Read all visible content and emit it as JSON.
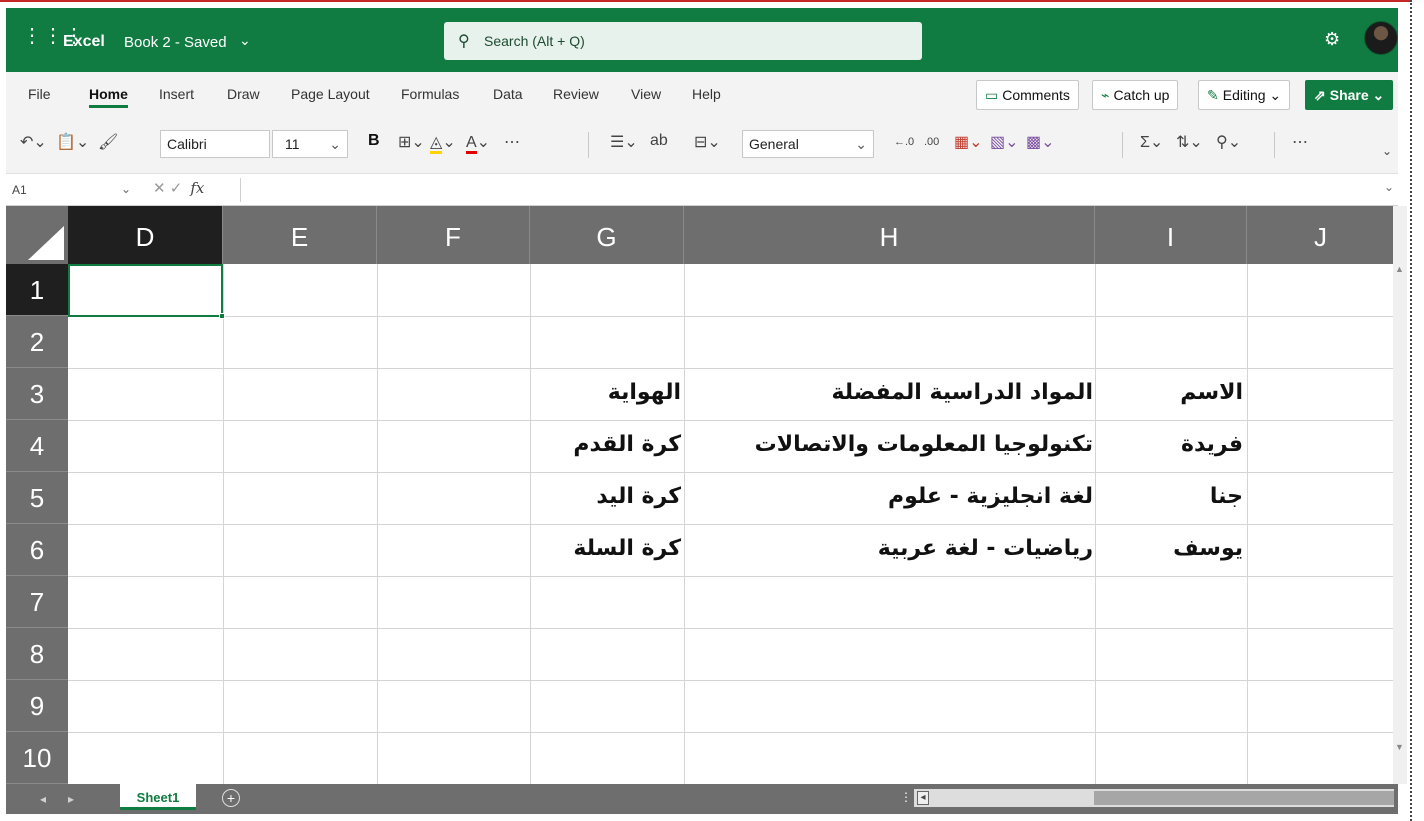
{
  "titlebar": {
    "app_name": "Excel",
    "doc_name": "Book 2 - Saved",
    "search_placeholder": "Search (Alt + Q)"
  },
  "menu": {
    "tabs": [
      "File",
      "Home",
      "Insert",
      "Draw",
      "Page Layout",
      "Formulas",
      "Data",
      "Review",
      "View",
      "Help"
    ],
    "active_tab": "Home",
    "comments_label": "Comments",
    "catchup_label": "Catch up",
    "editing_label": "Editing",
    "share_label": "Share"
  },
  "toolbar": {
    "font_name": "Calibri",
    "font_size": "11",
    "number_format": "General",
    "bold_label": "B"
  },
  "formula_bar": {
    "name_box": "A1",
    "fx_label": "fx"
  },
  "grid": {
    "columns": [
      "D",
      "E",
      "F",
      "G",
      "H",
      "I",
      "J"
    ],
    "selected_column": "D",
    "rows": [
      "1",
      "2",
      "3",
      "4",
      "5",
      "6",
      "7",
      "8",
      "9",
      "10"
    ],
    "selected_row": "1",
    "cells": {
      "I3": "الاسم",
      "H3": "المواد الدراسية المفضلة",
      "G3": "الهواية",
      "I4": "فريدة",
      "H4": "تكنولوجيا المعلومات والاتصالات",
      "G4": "كرة القدم",
      "I5": "جنا",
      "H5": "لغة انجليزية - علوم",
      "G5": "كرة اليد",
      "I6": "يوسف",
      "H6": "رياضيات - لغة عربية",
      "G6": "كرة السلة"
    }
  },
  "sheets": {
    "active": "Sheet1"
  },
  "colors": {
    "accent": "#107c41",
    "header_bg": "#6e6e6e",
    "selected_header_bg": "#1f1f1f"
  }
}
